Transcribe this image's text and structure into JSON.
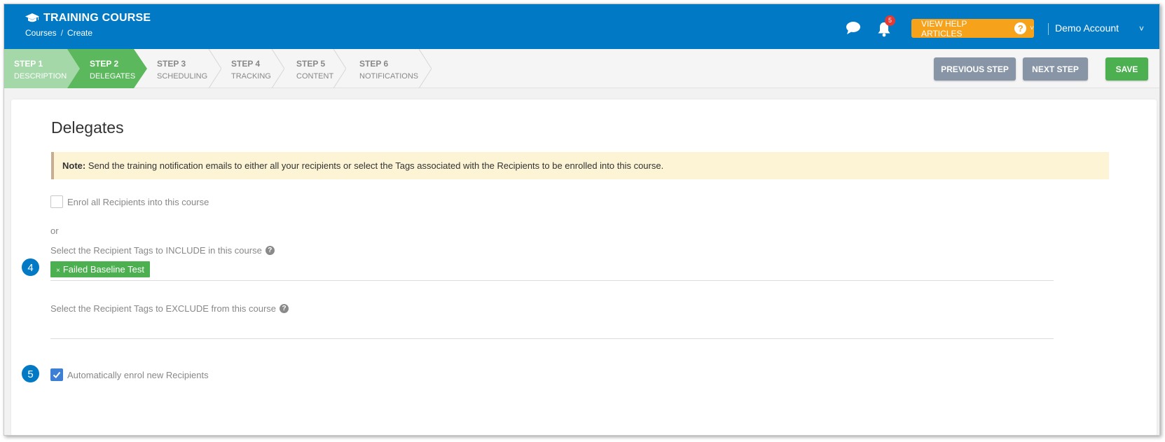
{
  "header": {
    "title": "TRAINING COURSE",
    "breadcrumb": [
      "Courses",
      "Create"
    ],
    "breadcrumb_sep": "/",
    "notifications_count": "5",
    "help_label": "VIEW HELP ARTICLES",
    "help_q": "?",
    "help_chevron": "˅",
    "account_name": "Demo Account",
    "account_chevron": "˅"
  },
  "steps": [
    {
      "num": "STEP 1",
      "label": "DESCRIPTION"
    },
    {
      "num": "STEP 2",
      "label": "DELEGATES"
    },
    {
      "num": "STEP 3",
      "label": "SCHEDULING"
    },
    {
      "num": "STEP 4",
      "label": "TRACKING"
    },
    {
      "num": "STEP 5",
      "label": "CONTENT"
    },
    {
      "num": "STEP 6",
      "label": "NOTIFICATIONS"
    }
  ],
  "actions": {
    "previous": "PREVIOUS STEP",
    "next": "NEXT STEP",
    "save": "SAVE"
  },
  "page": {
    "title": "Delegates",
    "note_bold": "Note:",
    "note_text": " Send the training notification emails to either all your recipients or select the Tags associated with the Recipients to be enrolled into this course.",
    "enrol_all_label": "Enrol all Recipients into this course",
    "or": "or",
    "include_label": "Select the Recipient Tags to INCLUDE in this course",
    "include_tags": [
      "Failed Baseline Test"
    ],
    "tag_remove": "×",
    "exclude_label": "Select the Recipient Tags to EXCLUDE from this course",
    "auto_enrol_label": "Automatically enrol new Recipients",
    "qmark": "?"
  },
  "markers": [
    "4",
    "5"
  ],
  "colors": {
    "header_blue": "#0279c5",
    "step_done": "#a5d8a8",
    "step_active": "#5cb85c",
    "help_orange": "#f7a21b",
    "save_green": "#4caf50",
    "gray_btn": "#8795a6",
    "note_bg": "#fcf4d4"
  }
}
